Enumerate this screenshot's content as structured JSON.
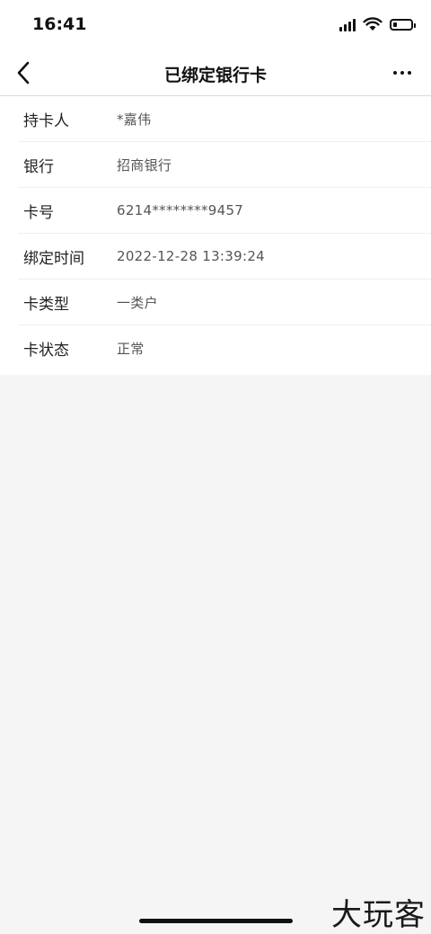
{
  "status_bar": {
    "time": "16:41",
    "battery_level": 0.22
  },
  "nav": {
    "title": "已绑定银行卡",
    "back_icon": "chevron-left-icon",
    "more_icon": "more-horizontal-icon"
  },
  "card_info": [
    {
      "label": "持卡人",
      "value": "*嘉伟"
    },
    {
      "label": "银行",
      "value": "招商银行"
    },
    {
      "label": "卡号",
      "value": "6214********9457"
    },
    {
      "label": "绑定时间",
      "value": "2022-12-28 13:39:24"
    },
    {
      "label": "卡类型",
      "value": "一类户"
    },
    {
      "label": "卡状态",
      "value": "正常"
    }
  ],
  "watermark": "大玩客"
}
